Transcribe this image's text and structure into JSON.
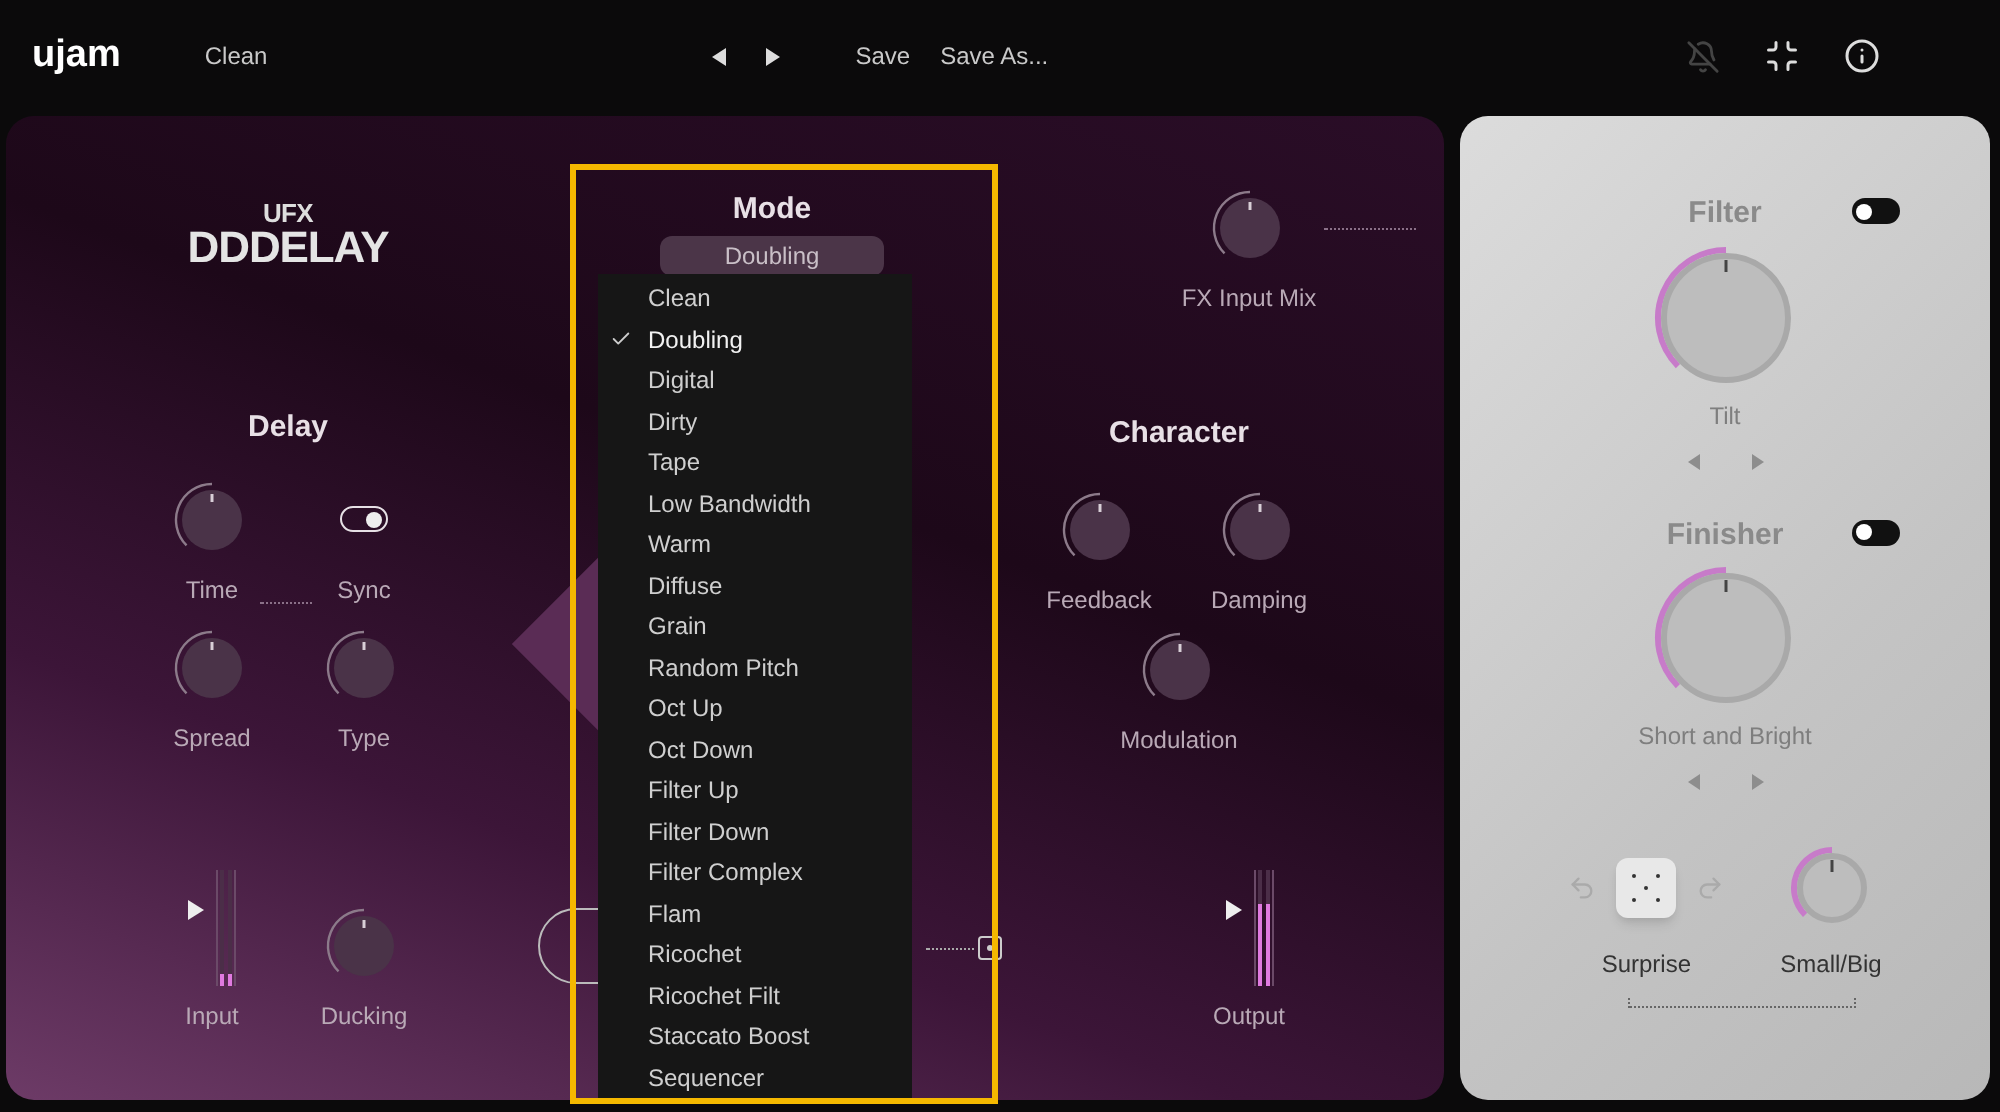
{
  "top_bar": {
    "logo": "ujam",
    "preset": "Clean",
    "buttons": [
      "Save",
      "Save As..."
    ]
  },
  "logo": {
    "top": "UFX",
    "main": "DDDELAY"
  },
  "delay": {
    "title": "Delay",
    "controls": [
      {
        "kind": "knob",
        "label": "Time"
      },
      {
        "kind": "toggle",
        "label": "Sync",
        "on": true
      },
      {
        "kind": "knob",
        "label": "Spread"
      },
      {
        "kind": "knob",
        "label": "Type"
      }
    ]
  },
  "bottom_left": [
    {
      "kind": "meter",
      "label": "Input",
      "level": 0.1
    },
    {
      "kind": "knob",
      "label": "Ducking"
    }
  ],
  "mode": {
    "title": "Mode",
    "value": "Doubling",
    "options": [
      {
        "label": "Clean",
        "selected": false
      },
      {
        "label": "Doubling",
        "selected": true
      },
      {
        "label": "Digital",
        "selected": false
      },
      {
        "label": "Dirty",
        "selected": false
      },
      {
        "label": "Tape",
        "selected": false
      },
      {
        "label": "Low Bandwidth",
        "selected": false
      },
      {
        "label": "Warm",
        "selected": false
      },
      {
        "label": "Diffuse",
        "selected": false
      },
      {
        "label": "Grain",
        "selected": false
      },
      {
        "label": "Random Pitch",
        "selected": false
      },
      {
        "label": "Oct Up",
        "selected": false
      },
      {
        "label": "Oct Down",
        "selected": false
      },
      {
        "label": "Filter Up",
        "selected": false
      },
      {
        "label": "Filter Down",
        "selected": false
      },
      {
        "label": "Filter Complex",
        "selected": false
      },
      {
        "label": "Flam",
        "selected": false
      },
      {
        "label": "Ricochet",
        "selected": false
      },
      {
        "label": "Ricochet Filt",
        "selected": false
      },
      {
        "label": "Staccato Boost",
        "selected": false
      },
      {
        "label": "Sequencer",
        "selected": false
      }
    ]
  },
  "fx_input_mix": {
    "kind": "knob",
    "label": "FX Input Mix"
  },
  "character": {
    "title": "Character",
    "controls": [
      {
        "kind": "knob",
        "label": "Feedback"
      },
      {
        "kind": "knob",
        "label": "Damping"
      },
      {
        "kind": "knob",
        "label": "Modulation"
      }
    ]
  },
  "output": {
    "kind": "meter",
    "label": "Output",
    "level": 0.7
  },
  "finisher_panel": {
    "sections": [
      {
        "title": "Filter",
        "on": false,
        "knob_label": "Tilt"
      },
      {
        "title": "Finisher",
        "on": false,
        "knob_label": "Short and Bright"
      }
    ],
    "surprise": "Surprise",
    "small_big": {
      "label": "Small/Big"
    }
  }
}
